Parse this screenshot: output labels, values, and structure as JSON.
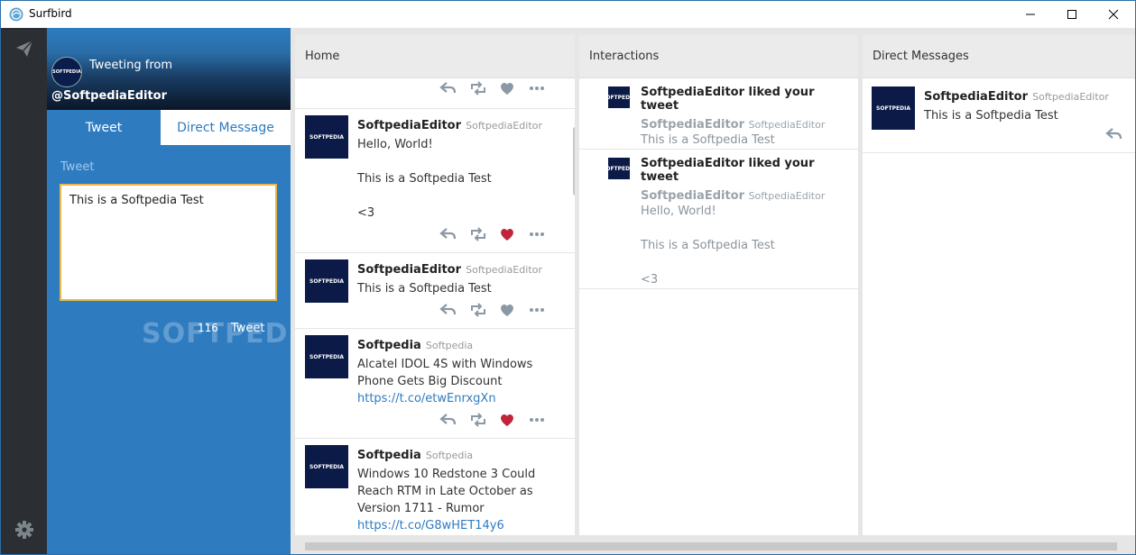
{
  "app": {
    "title": "Surfbird"
  },
  "compose": {
    "tweeting_from": "Tweeting from",
    "handle": "@SoftpediaEditor",
    "avatar_text": "SOFTPEDIA",
    "tabs": [
      "Tweet",
      "Direct Message"
    ],
    "label": "Tweet",
    "text": "This is a Softpedia Test",
    "watermark": "SOFTPEDIA",
    "char_count": "116",
    "send_label": "Tweet"
  },
  "columns": {
    "home": {
      "title": "Home",
      "tweets": [
        {
          "name": "SoftpediaEditor",
          "screen": "SoftpediaEditor",
          "lines": [
            "Hello, World!",
            "",
            "This is a Softpedia Test",
            "",
            "<3"
          ],
          "liked": true
        },
        {
          "name": "SoftpediaEditor",
          "screen": "SoftpediaEditor",
          "lines": [
            "This is a Softpedia Test"
          ],
          "liked": false
        },
        {
          "name": "Softpedia",
          "screen": "Softpedia",
          "lines": [
            "Alcatel IDOL 4S with Windows",
            "Phone Gets Big Discount"
          ],
          "link": "https://t.co/etwEnrxgXn",
          "liked": true
        },
        {
          "name": "Softpedia",
          "screen": "Softpedia",
          "lines": [
            "Windows 10 Redstone 3 Could",
            "Reach RTM in Late October as",
            "Version 1711 - Rumor"
          ],
          "link": "https://t.co/G8wHET14y6",
          "liked": false
        }
      ]
    },
    "interactions": {
      "title": "Interactions",
      "items": [
        {
          "headline": "SoftpediaEditor liked your tweet",
          "name": "SoftpediaEditor",
          "screen": "SoftpediaEditor",
          "lines": [
            "This is a Softpedia Test"
          ]
        },
        {
          "headline": "SoftpediaEditor liked your tweet",
          "name": "SoftpediaEditor",
          "screen": "SoftpediaEditor",
          "lines": [
            "Hello, World!",
            "",
            "This is a Softpedia Test",
            "",
            "<3"
          ]
        }
      ]
    },
    "dms": {
      "title": "Direct Messages",
      "items": [
        {
          "name": "SoftpediaEditor",
          "screen": "SoftpediaEditor",
          "text": "This is a Softpedia Test"
        }
      ]
    }
  },
  "colors": {
    "accent": "#2e7bc0",
    "rail": "#2b2f34",
    "like": "#c0243a",
    "icon": "#8b98a5"
  }
}
